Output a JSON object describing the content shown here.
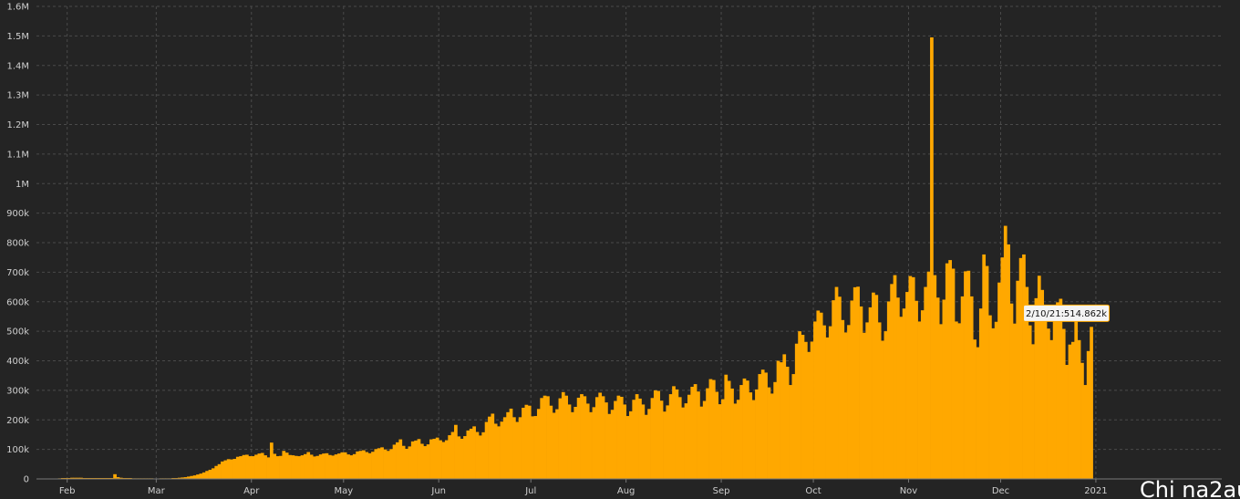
{
  "chart_data": {
    "type": "bar",
    "title": "",
    "xlabel": "",
    "ylabel": "",
    "ylim": [
      0,
      1600000
    ],
    "grid": true,
    "legend": "none",
    "bar_color": "#ffa800",
    "background": "#242424",
    "y_ticks": [
      {
        "value": 0,
        "label": "0"
      },
      {
        "value": 100000,
        "label": "100k"
      },
      {
        "value": 200000,
        "label": "200k"
      },
      {
        "value": 300000,
        "label": "300k"
      },
      {
        "value": 400000,
        "label": "400k"
      },
      {
        "value": 500000,
        "label": "500k"
      },
      {
        "value": 600000,
        "label": "600k"
      },
      {
        "value": 700000,
        "label": "700k"
      },
      {
        "value": 800000,
        "label": "800k"
      },
      {
        "value": 900000,
        "label": "900k"
      },
      {
        "value": 1000000,
        "label": "1M"
      },
      {
        "value": 1100000,
        "label": "1.1M"
      },
      {
        "value": 1200000,
        "label": "1.2M"
      },
      {
        "value": 1300000,
        "label": "1.3M"
      },
      {
        "value": 1400000,
        "label": "1.4M"
      },
      {
        "value": 1500000,
        "label": "1.5M"
      },
      {
        "value": 1600000,
        "label": "1.6M"
      }
    ],
    "x_range": [
      "2020-01-22",
      "2021-02-10"
    ],
    "x_ticks": [
      {
        "date": "2020-02-01",
        "label": "Feb"
      },
      {
        "date": "2020-03-01",
        "label": "Mar"
      },
      {
        "date": "2020-04-01",
        "label": "Apr"
      },
      {
        "date": "2020-05-01",
        "label": "May"
      },
      {
        "date": "2020-06-01",
        "label": "Jun"
      },
      {
        "date": "2020-07-01",
        "label": "Jul"
      },
      {
        "date": "2020-08-01",
        "label": "Aug"
      },
      {
        "date": "2020-09-01",
        "label": "Sep"
      },
      {
        "date": "2020-10-01",
        "label": "Oct"
      },
      {
        "date": "2020-11-01",
        "label": "Nov"
      },
      {
        "date": "2020-12-01",
        "label": "Dec"
      },
      {
        "date": "2021-01-01",
        "label": "2021"
      }
    ],
    "series": [
      {
        "start_date": "2020-01-22",
        "interval": "day",
        "values": [
          0,
          0,
          0,
          0,
          0,
          0,
          0,
          2000,
          3000,
          3000,
          3000,
          4000,
          4000,
          4000,
          4000,
          3000,
          3000,
          3000,
          3000,
          3000,
          3000,
          3000,
          3000,
          3000,
          3000,
          16000,
          6000,
          4000,
          3000,
          3000,
          3000,
          2000,
          2000,
          2000,
          2000,
          2000,
          2000,
          2000,
          1000,
          1000,
          2000,
          2000,
          2000,
          2000,
          3000,
          3000,
          4000,
          5000,
          6000,
          8000,
          10000,
          12000,
          15000,
          18000,
          22000,
          27000,
          31000,
          36000,
          44000,
          50000,
          59000,
          63000,
          67000,
          66000,
          68000,
          75000,
          77000,
          81000,
          82000,
          77000,
          77000,
          82000,
          86000,
          88000,
          80000,
          73000,
          123000,
          85000,
          77000,
          78000,
          95000,
          89000,
          81000,
          80000,
          78000,
          77000,
          80000,
          84000,
          91000,
          82000,
          76000,
          78000,
          83000,
          86000,
          87000,
          81000,
          79000,
          83000,
          86000,
          90000,
          90000,
          83000,
          80000,
          84000,
          93000,
          95000,
          97000,
          91000,
          87000,
          92000,
          101000,
          104000,
          107000,
          100000,
          95000,
          101000,
          116000,
          124000,
          134000,
          112000,
          102000,
          110000,
          127000,
          130000,
          135000,
          119000,
          111000,
          117000,
          134000,
          136000,
          140000,
          131000,
          125000,
          131000,
          148000,
          159000,
          183000,
          144000,
          136000,
          145000,
          164000,
          170000,
          178000,
          159000,
          147000,
          158000,
          193000,
          211000,
          221000,
          187000,
          178000,
          194000,
          209000,
          226000,
          238000,
          209000,
          193000,
          209000,
          241000,
          251000,
          248000,
          212000,
          213000,
          237000,
          274000,
          282000,
          280000,
          248000,
          224000,
          236000,
          273000,
          294000,
          282000,
          252000,
          226000,
          244000,
          275000,
          287000,
          280000,
          255000,
          226000,
          243000,
          277000,
          292000,
          280000,
          259000,
          220000,
          234000,
          264000,
          282000,
          278000,
          252000,
          213000,
          229000,
          268000,
          287000,
          272000,
          252000,
          217000,
          237000,
          274000,
          300000,
          298000,
          265000,
          228000,
          249000,
          287000,
          314000,
          303000,
          277000,
          242000,
          256000,
          285000,
          312000,
          321000,
          296000,
          245000,
          264000,
          307000,
          338000,
          335000,
          295000,
          253000,
          270000,
          353000,
          332000,
          306000,
          255000,
          268000,
          318000,
          340000,
          333000,
          293000,
          267000,
          303000,
          355000,
          370000,
          360000,
          310000,
          289000,
          328000,
          400000,
          395000,
          422000,
          380000,
          318000,
          355000,
          458000,
          500000,
          488000,
          464000,
          430000,
          465000,
          533000,
          570000,
          563000,
          520000,
          479000,
          517000,
          605000,
          650000,
          617000,
          538000,
          496000,
          521000,
          604000,
          649000,
          651000,
          584000,
          495000,
          530000,
          581000,
          631000,
          623000,
          530000,
          468000,
          500000,
          601000,
          660000,
          690000,
          614000,
          549000,
          577000,
          633000,
          687000,
          683000,
          603000,
          533000,
          571000,
          650000,
          702000,
          1495000,
          690000,
          614000,
          524000,
          607000,
          730000,
          741000,
          712000,
          533000,
          527000,
          618000,
          703000,
          705000,
          618000,
          472000,
          446000,
          577000,
          760000,
          721000,
          554000,
          510000,
          532000,
          665000,
          750000,
          857000,
          794000,
          594000,
          526000,
          671000,
          748000,
          760000,
          650000,
          520000,
          456000,
          612000,
          688000,
          640000,
          557000,
          509000,
          470000,
          580000,
          598000,
          610000,
          508000,
          386000,
          455000,
          464000,
          534000,
          470000,
          393000,
          318000,
          433000,
          514862
        ]
      }
    ],
    "tooltip": "2/10/21:514.862k",
    "watermark": "Chi na2au"
  }
}
